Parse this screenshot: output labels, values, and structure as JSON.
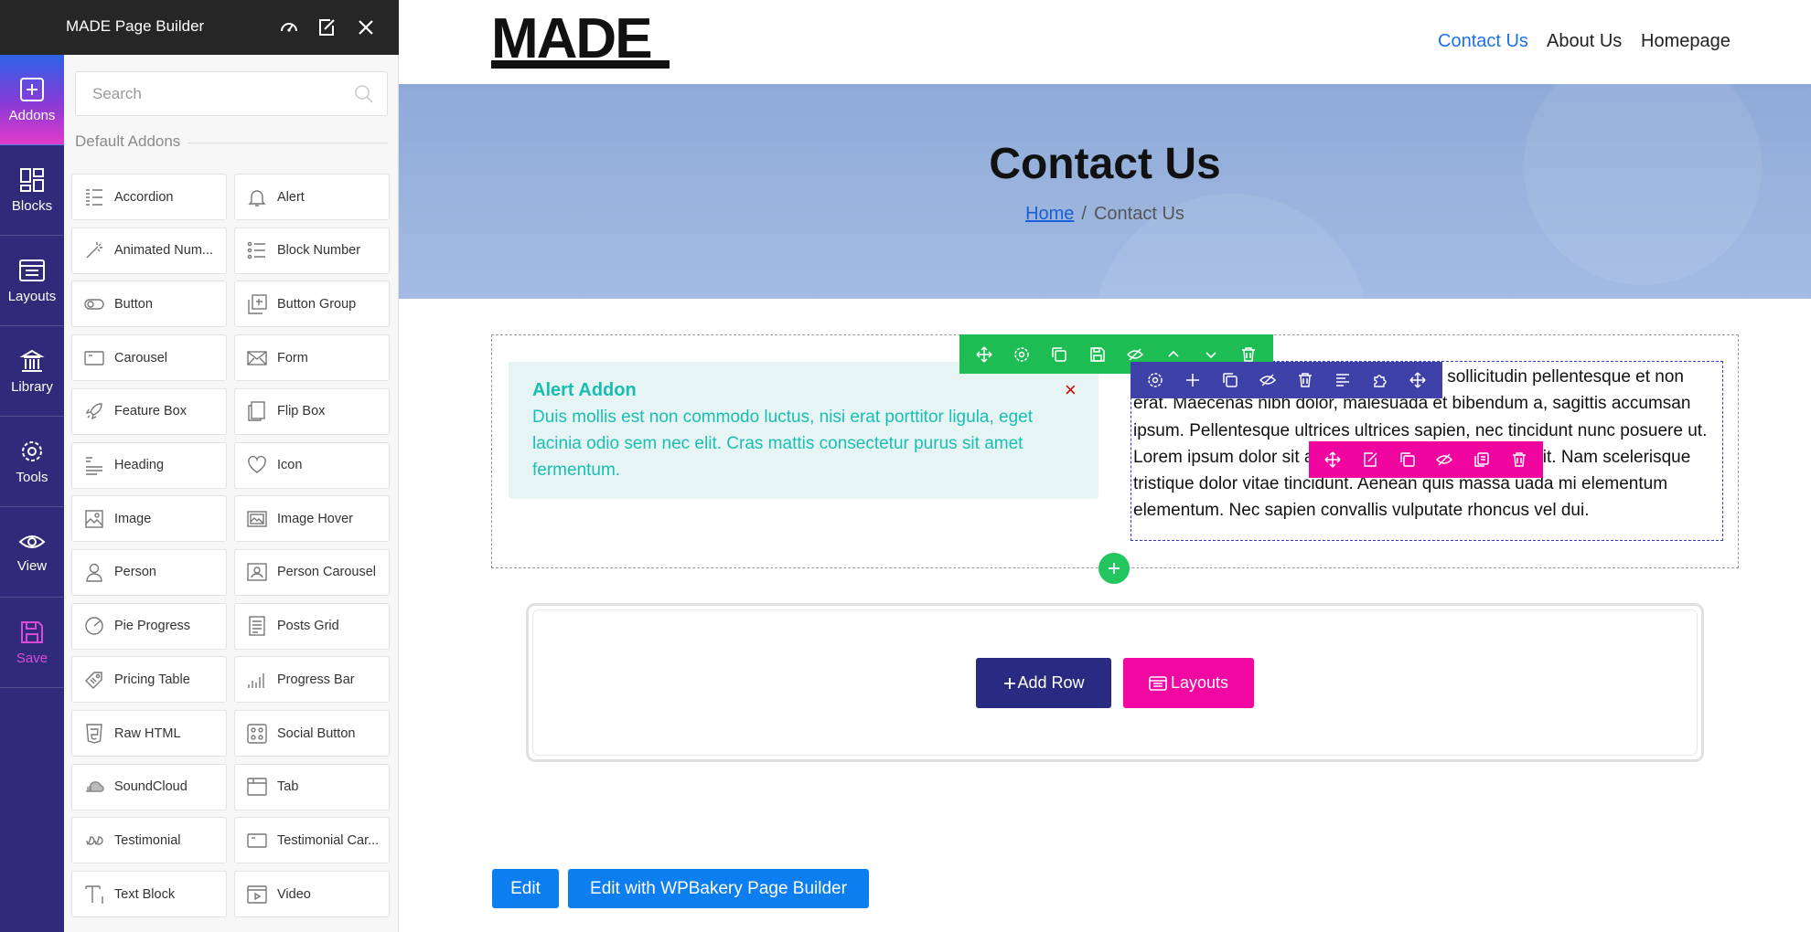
{
  "builder": {
    "title": "MADE Page Builder",
    "search_placeholder": "Search",
    "section_label": "Default Addons"
  },
  "rail": {
    "items": [
      {
        "label": "Addons",
        "icon": "plus-square-icon"
      },
      {
        "label": "Blocks",
        "icon": "blocks-icon"
      },
      {
        "label": "Layouts",
        "icon": "layouts-icon"
      },
      {
        "label": "Library",
        "icon": "library-icon"
      },
      {
        "label": "Tools",
        "icon": "gear-icon"
      },
      {
        "label": "View",
        "icon": "eye-icon"
      },
      {
        "label": "Save",
        "icon": "save-icon"
      }
    ]
  },
  "addons": [
    {
      "label": "Accordion",
      "icon": "accordion-icon"
    },
    {
      "label": "Alert",
      "icon": "bell-icon"
    },
    {
      "label": "Animated Num...",
      "icon": "magic-wand-icon"
    },
    {
      "label": "Block Number",
      "icon": "numbered-list-icon"
    },
    {
      "label": "Button",
      "icon": "toggle-button-icon"
    },
    {
      "label": "Button Group",
      "icon": "button-group-icon"
    },
    {
      "label": "Carousel",
      "icon": "carousel-icon"
    },
    {
      "label": "Form",
      "icon": "envelope-icon"
    },
    {
      "label": "Feature Box",
      "icon": "rocket-icon"
    },
    {
      "label": "Flip Box",
      "icon": "flip-box-icon"
    },
    {
      "label": "Heading",
      "icon": "heading-icon"
    },
    {
      "label": "Icon",
      "icon": "heart-icon"
    },
    {
      "label": "Image",
      "icon": "image-icon"
    },
    {
      "label": "Image Hover",
      "icon": "image-hover-icon"
    },
    {
      "label": "Person",
      "icon": "person-icon"
    },
    {
      "label": "Person Carousel",
      "icon": "person-carousel-icon"
    },
    {
      "label": "Pie Progress",
      "icon": "pie-progress-icon"
    },
    {
      "label": "Posts Grid",
      "icon": "posts-grid-icon"
    },
    {
      "label": "Pricing Table",
      "icon": "price-tag-icon"
    },
    {
      "label": "Progress Bar",
      "icon": "progress-bar-icon"
    },
    {
      "label": "Raw HTML",
      "icon": "html5-icon"
    },
    {
      "label": "Social Button",
      "icon": "social-button-icon"
    },
    {
      "label": "SoundCloud",
      "icon": "soundcloud-icon"
    },
    {
      "label": "Tab",
      "icon": "tab-icon"
    },
    {
      "label": "Testimonial",
      "icon": "quote-icon"
    },
    {
      "label": "Testimonial Car...",
      "icon": "testimonial-carousel-icon"
    },
    {
      "label": "Text Block",
      "icon": "text-block-icon"
    },
    {
      "label": "Video",
      "icon": "video-icon"
    }
  ],
  "site": {
    "brand": "MADE",
    "nav": [
      "Contact Us",
      "About Us",
      "Homepage"
    ],
    "nav_active_color": "#1a73e8",
    "hero_title": "Contact Us",
    "breadcrumb_home": "Home",
    "breadcrumb_sep": "/",
    "breadcrumb_current": "Contact Us"
  },
  "alert_addon": {
    "title": "Alert Addon",
    "text": "Duis mollis est non commodo luctus, nisi erat porttitor ligula, eget lacinia odio sem nec elit. Cras mattis consectetur purus sit amet fermentum.",
    "close": "×"
  },
  "text_block": {
    "text": "Lorem ipsum dolor sit amet, consectetur sollicitudin pellentesque et non erat. Maecenas nibh dolor, malesuada et bibendum a, sagittis accumsan ipsum. Pellentesque ultrices ultrices sapien, nec tincidunt nunc posuere ut. Lorem ipsum dolor sit amet, consectetur adipiscing elit. Nam scelerisque tristique dolor vitae tincidunt. Aenean quis massa uada mi elementum elementum. Nec sapien convallis vulputate rhoncus vel dui."
  },
  "toolbars": {
    "row": [
      "move-icon",
      "gear-icon",
      "copy-icon",
      "save-icon",
      "eye-slash-icon",
      "chevron-up-icon",
      "chevron-down-icon",
      "trash-icon"
    ],
    "column": [
      "gear-icon",
      "plus-icon",
      "copy-icon",
      "eye-slash-icon",
      "trash-icon",
      "align-icon",
      "puzzle-icon",
      "move-icon"
    ],
    "addon": [
      "move-icon",
      "edit-icon",
      "copy-icon",
      "eye-slash-icon",
      "duplicate-icon",
      "trash-icon"
    ]
  },
  "actions": {
    "add_row": "Add Row",
    "layouts": "Layouts",
    "edit": "Edit",
    "edit_wpbakery": "Edit with WPBakery Page Builder"
  }
}
